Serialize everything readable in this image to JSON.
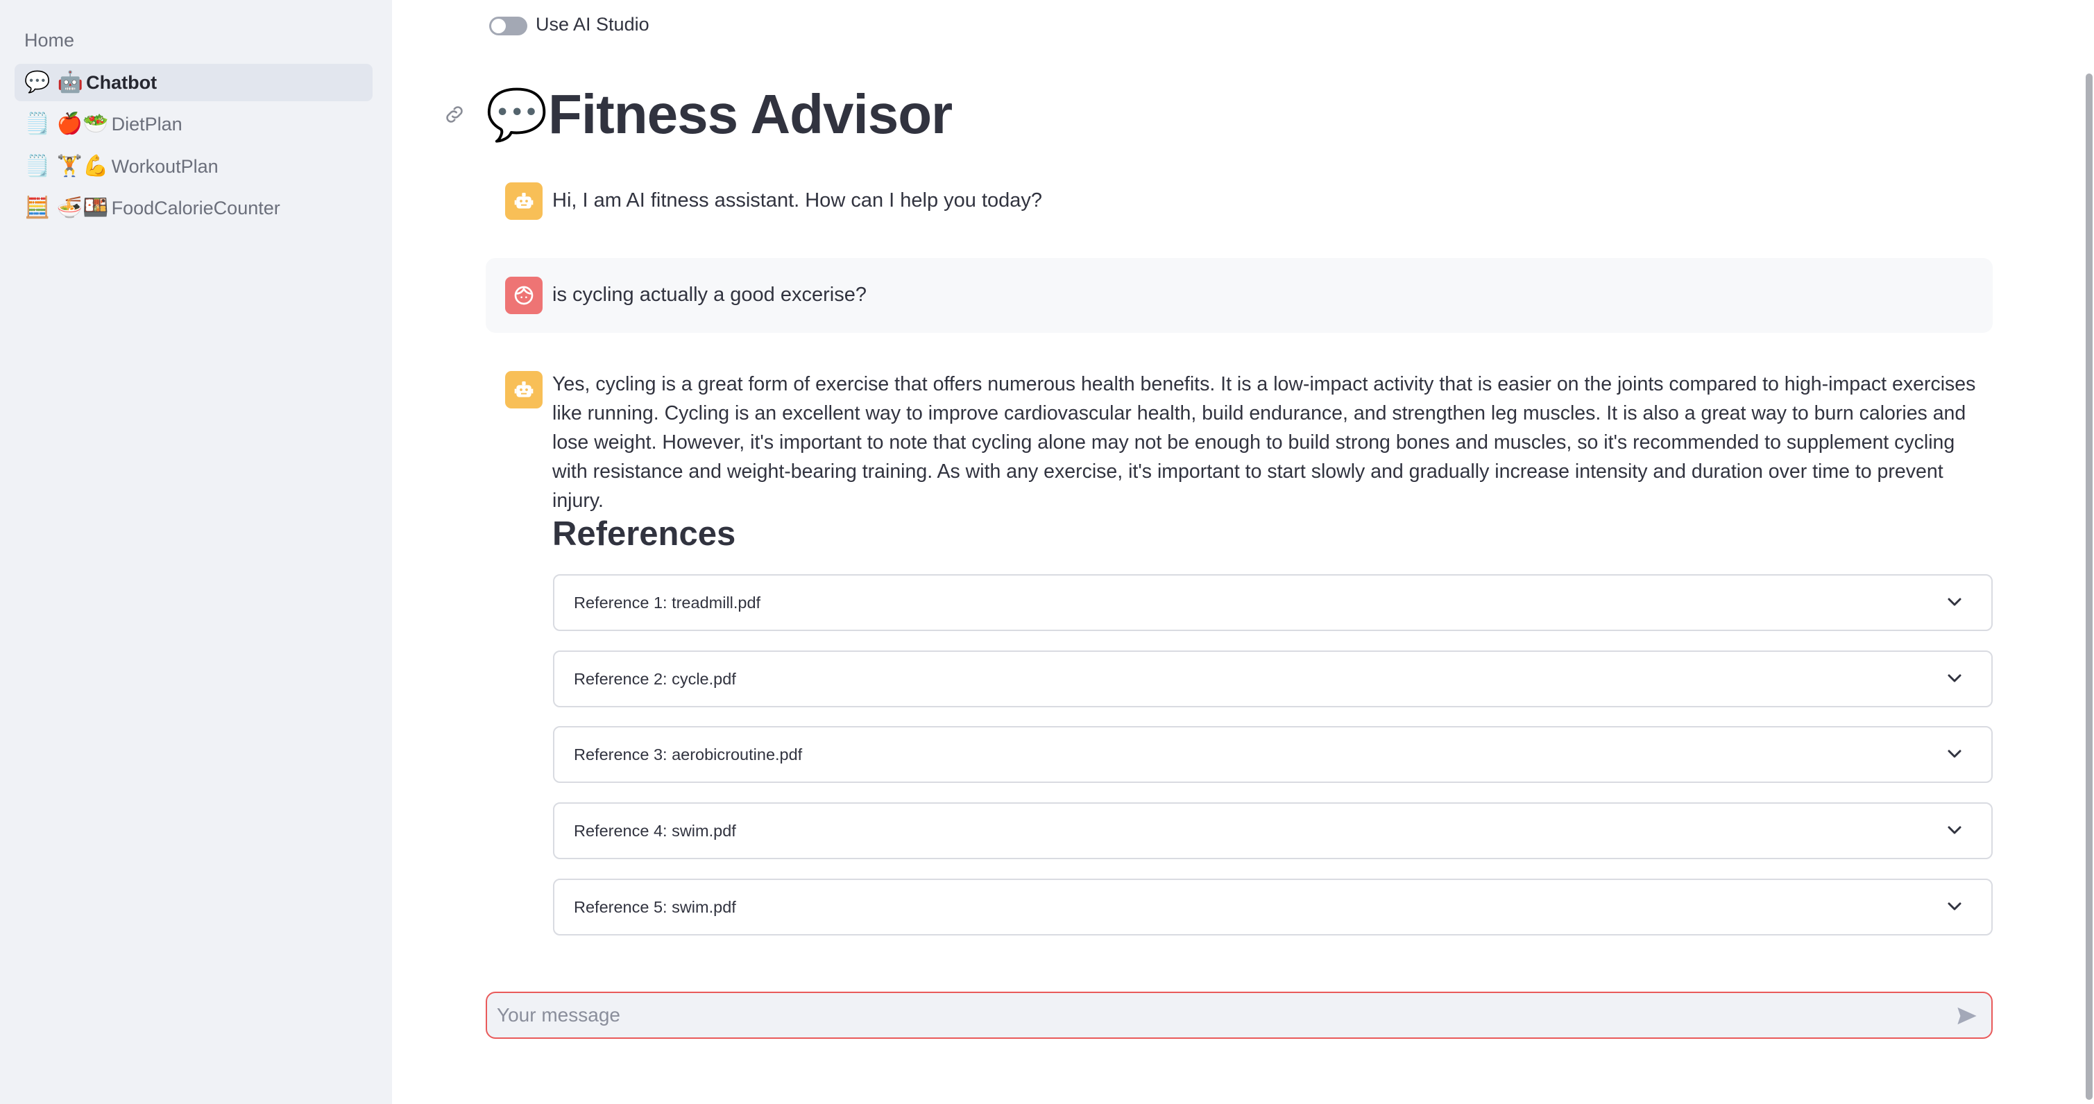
{
  "sidebar": {
    "home_label": "Home",
    "items": [
      {
        "icons": "💬 🤖",
        "label": "Chatbot",
        "active": true
      },
      {
        "icons": "🗒️ 🍎🥗",
        "label": "DietPlan",
        "active": false
      },
      {
        "icons": "🗒️ 🏋️💪",
        "label": "WorkoutPlan",
        "active": false
      },
      {
        "icons": "🧮 🍜🍱",
        "label": "FoodCalorieCounter",
        "active": false
      }
    ]
  },
  "toggle": {
    "label": "Use AI Studio",
    "checked": false
  },
  "header": {
    "emoji": "💬",
    "title": "Fitness Advisor",
    "anchor_icon": "link-icon"
  },
  "messages": [
    {
      "role": "assistant",
      "avatar_icon": "robot-icon",
      "text": "Hi, I am AI fitness assistant. How can I help you today?"
    },
    {
      "role": "user",
      "avatar_icon": "user-face-icon",
      "text": "is cycling actually a good excerise?"
    },
    {
      "role": "assistant",
      "avatar_icon": "robot-icon",
      "text": "Yes, cycling is a great form of exercise that offers numerous health benefits. It is a low-impact activity that is easier on the joints compared to high-impact exercises like running. Cycling is an excellent way to improve cardiovascular health, build endurance, and strengthen leg muscles. It is also a great way to burn calories and lose weight. However, it's important to note that cycling alone may not be enough to build strong bones and muscles, so it's recommended to supplement cycling with resistance and weight-bearing training. As with any exercise, it's important to start slowly and gradually increase intensity and duration over time to prevent injury."
    }
  ],
  "references": {
    "heading": "References",
    "items": [
      {
        "label": "Reference 1: treadmill.pdf"
      },
      {
        "label": "Reference 2: cycle.pdf"
      },
      {
        "label": "Reference 3: aerobicroutine.pdf"
      },
      {
        "label": "Reference 4: swim.pdf"
      },
      {
        "label": "Reference 5: swim.pdf"
      }
    ]
  },
  "chat_input": {
    "placeholder": "Your message",
    "value": "",
    "send_icon": "send-icon"
  },
  "colors": {
    "sidebar_bg": "#f0f2f6",
    "active_item_bg": "#e2e6ee",
    "bot_avatar": "#f8bf57",
    "user_avatar": "#ee7474",
    "input_border": "#e95a5a",
    "text": "#31333f"
  }
}
